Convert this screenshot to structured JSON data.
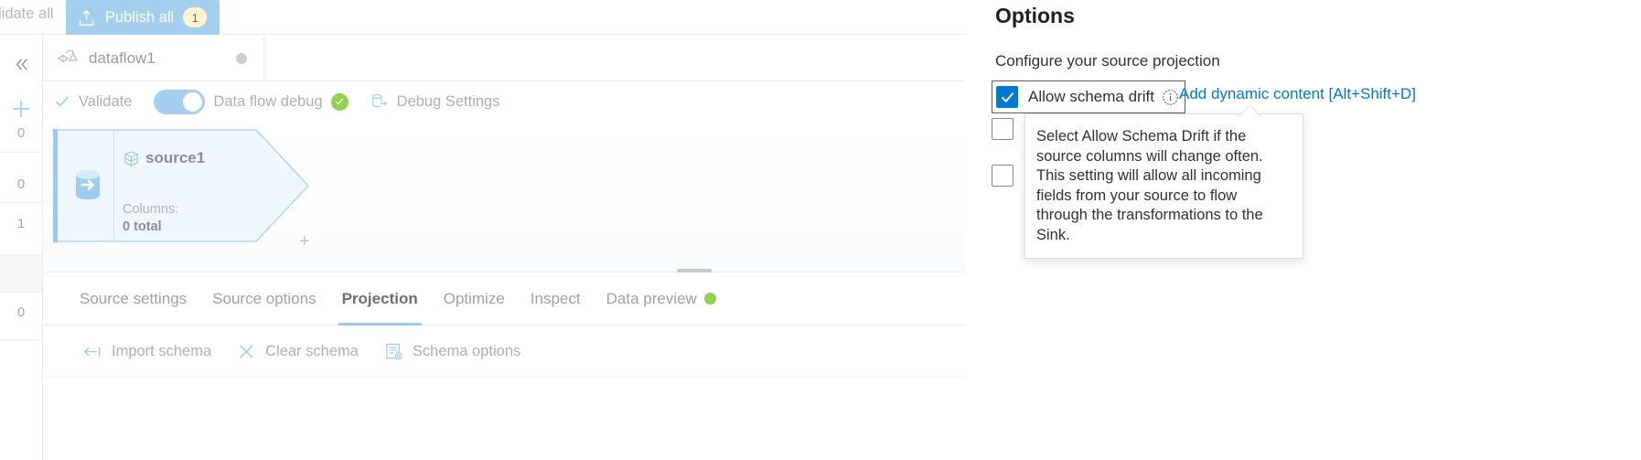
{
  "topbar": {
    "validate_all_label": "lidate all",
    "publish_all_label": "Publish all",
    "publish_all_badge": "1",
    "publish_icon": "upload-icon"
  },
  "breadcrumb": {
    "dataflow_tab_label": "dataflow1",
    "dataflow_tab_icon": "dataflow-icon",
    "collapse_icon": "chevron-double-left-icon",
    "add_icon": "plus-icon"
  },
  "commandbar": {
    "validate_label": "Validate",
    "validate_icon": "checkmark-icon",
    "debug_toggle_label": "Data flow debug",
    "debug_toggle_state": "on",
    "debug_status_icon": "success-check-icon",
    "debug_settings_label": "Debug Settings",
    "debug_settings_icon": "debug-database-icon"
  },
  "canvas": {
    "node": {
      "name": "source1",
      "title_icon": "dataset-icon",
      "source_icon": "source-database-icon",
      "meta_label": "Columns:",
      "meta_value": "0 total",
      "add_handle": "+"
    }
  },
  "gutter": {
    "rows": [
      "0",
      "0",
      "1",
      "",
      "0"
    ]
  },
  "panel": {
    "tabs": [
      {
        "label": "Source settings",
        "active": false
      },
      {
        "label": "Source options",
        "active": false
      },
      {
        "label": "Projection",
        "active": true
      },
      {
        "label": "Optimize",
        "active": false
      },
      {
        "label": "Inspect",
        "active": false
      },
      {
        "label": "Data preview",
        "active": false,
        "status_dot": "green"
      }
    ],
    "actions": [
      {
        "label": "Import schema",
        "icon": "import-arrow-icon"
      },
      {
        "label": "Clear schema",
        "icon": "close-x-icon"
      },
      {
        "label": "Schema options",
        "icon": "schema-options-icon"
      }
    ]
  },
  "options": {
    "title": "Options",
    "subtitle": "Configure your source projection",
    "allow_schema_drift": {
      "label": "Allow schema drift",
      "checked": true,
      "info_icon": "info-icon"
    },
    "dynamic_content_link": "Add dynamic content [Alt+Shift+D]",
    "other_rows": [
      {
        "label": "",
        "checked": false
      },
      {
        "label": "",
        "checked": false
      }
    ],
    "tooltip_text": "Select Allow Schema Drift if the source columns will change often. This setting will allow all incoming fields from your source to flow through the transformations to the Sink."
  },
  "colors": {
    "accent_blue": "#0078d4",
    "light_blue": "#a5cfee",
    "status_green": "#92d050",
    "badge_yellow": "#fdf3d0"
  }
}
